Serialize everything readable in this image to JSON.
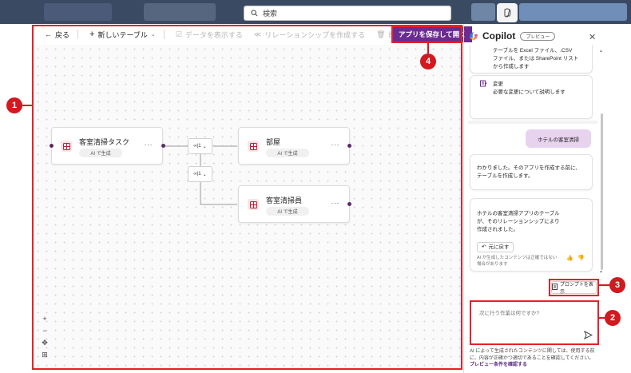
{
  "topbar": {
    "search_placeholder": "検索"
  },
  "toolbar": {
    "back": "戻る",
    "new_table": "新しいテーブル",
    "view_data": "データを表示する",
    "create_relationship": "リレーションシップを作成する",
    "delete": "削除",
    "save_open": "アプリを保存して開く"
  },
  "canvas": {
    "tables": [
      {
        "name": "客室清掃タスク",
        "badge": "AI で生成"
      },
      {
        "name": "部屋",
        "badge": "AI で生成"
      },
      {
        "name": "客室清掃員",
        "badge": "AI で生成"
      }
    ],
    "relation_label": "∞|1",
    "zoom": {
      "in": "+",
      "out": "−",
      "fit": "✥",
      "map": "⊞"
    }
  },
  "copilot": {
    "title": "Copilot",
    "preview_badge": "プレビュー",
    "messages": {
      "import_text_1": "テーブルを Excel ファイル、.CSV",
      "import_text_2": "ファイル、または SharePoint リスト",
      "import_text_3": "から作成します",
      "change_title": "変更",
      "change_desc": "必要な変更について説明します",
      "user_prompt": "ホテルの客室清掃",
      "reply1_line1": "わかりました。そのアプリを作成する前に、",
      "reply1_line2": "テーブルを作成します。",
      "reply2_line1": "ホテルの客室清掃アプリのテーブル",
      "reply2_line2": "が、そのリレーションシップにより",
      "reply2_line3": "作成されました。",
      "undo": "元に戻す",
      "ai_note_1": "AI が生成したコンテンツは正確ではない",
      "ai_note_2": "場合があります"
    },
    "show_prompts": "プロンプトを表示",
    "input_placeholder": "次に行う作業は何ですか?",
    "disclaimer_text": "AI によって生成されたコンテンツに関しては、使用する前に、内容が正確かつ適切であることを確認してください。",
    "disclaimer_link": "プレビュー条件を確認する"
  },
  "callouts": [
    "1",
    "2",
    "3",
    "4"
  ],
  "colors": {
    "accent": "#6b2c91",
    "callout": "#d1191f",
    "frame": "#e8202a",
    "user_bubble": "#e8d3ef"
  }
}
